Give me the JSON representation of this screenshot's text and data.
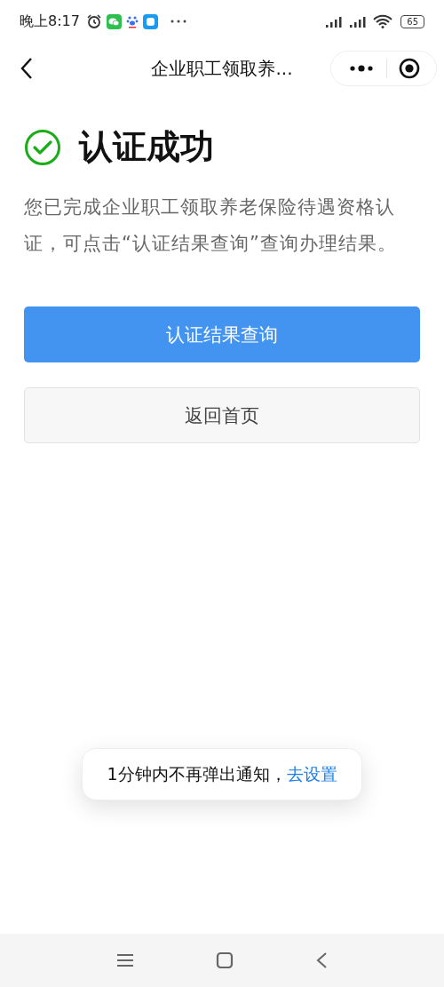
{
  "status_bar": {
    "time": "晚上8:17",
    "battery": "65"
  },
  "nav": {
    "title": "企业职工领取养..."
  },
  "result": {
    "title": "认证成功",
    "description": "您已完成企业职工领取养老保险待遇资格认证，可点击“认证结果查询”查询办理结果。"
  },
  "buttons": [
    {
      "label": "认证结果查询",
      "kind": "primary"
    },
    {
      "label": "返回首页",
      "kind": "secondary"
    }
  ],
  "toast": {
    "text": "1分钟内不再弹出通知，",
    "link": "去设置"
  }
}
